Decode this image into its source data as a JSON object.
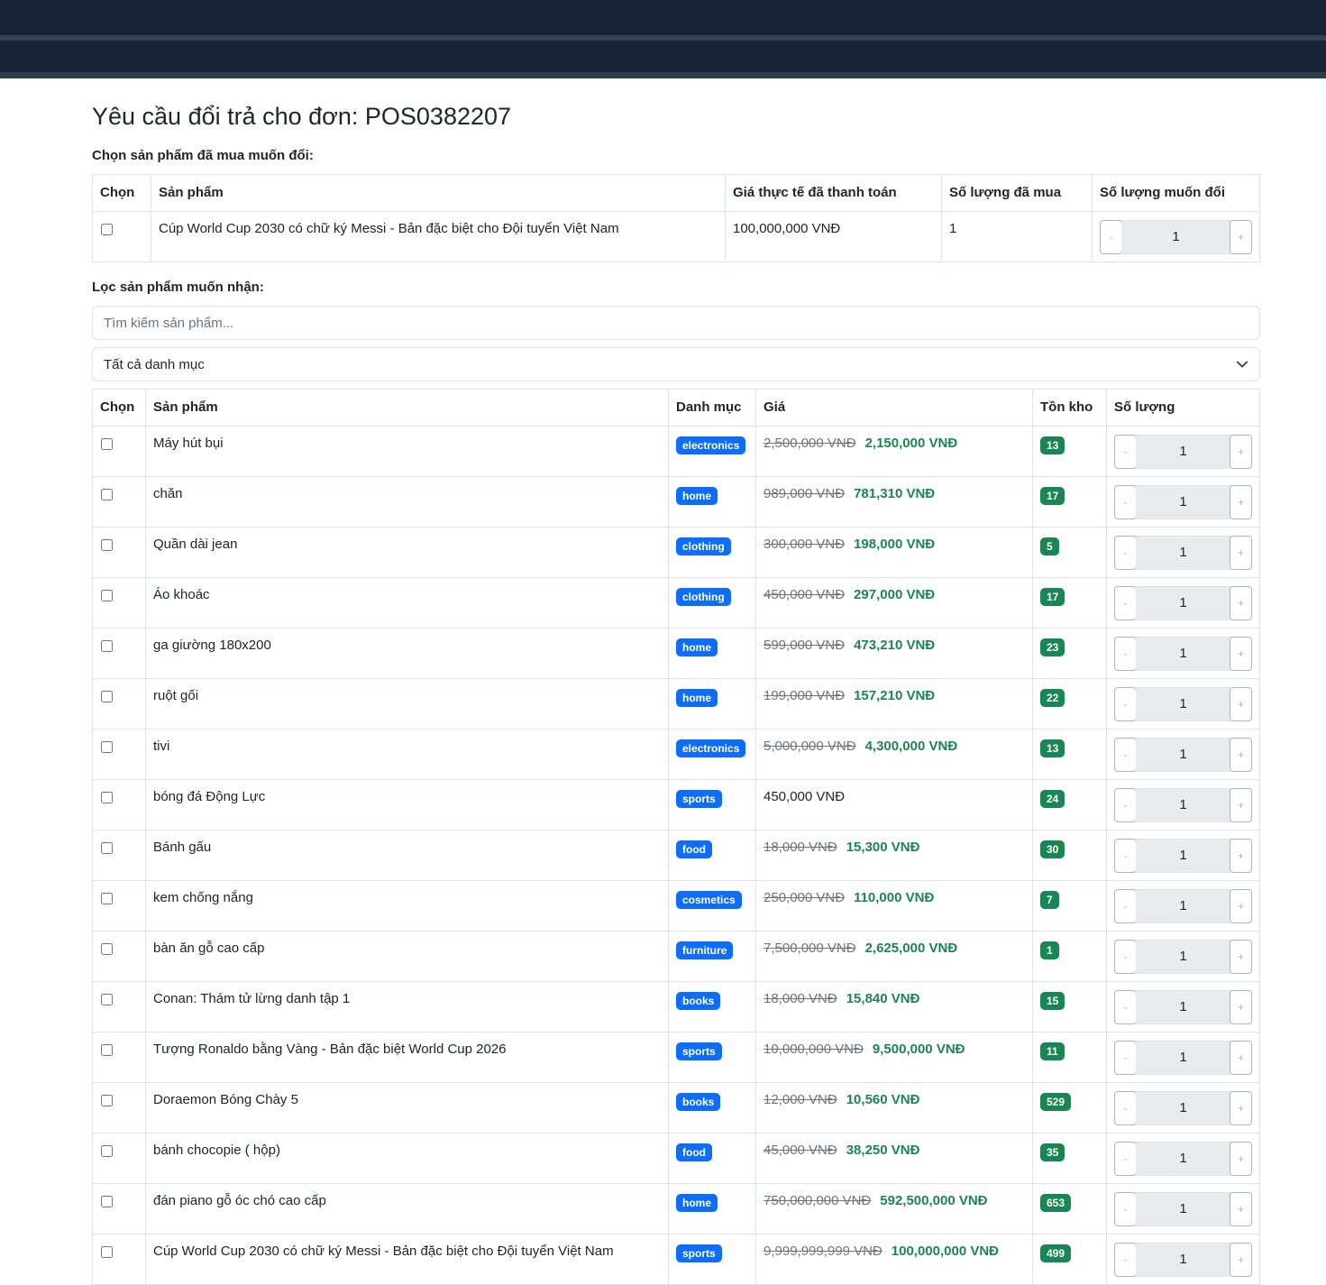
{
  "page_title": "Yêu cầu đổi trả cho đơn: POS0382207",
  "purchased_section": {
    "label": "Chọn sản phẩm đã mua muốn đổi:",
    "headers": [
      "Chọn",
      "Sản phẩm",
      "Giá thực tế đã thanh toán",
      "Số lượng đã mua",
      "Số lượng muốn đổi"
    ],
    "rows": [
      {
        "name": "Cúp World Cup 2030 có chữ ký Messi - Bản đặc biệt cho Đội tuyển Việt Nam",
        "paid": "100,000,000 VNĐ",
        "bought": "1",
        "qty": "1"
      }
    ]
  },
  "filter_section": {
    "label": "Lọc sản phẩm muốn nhận:",
    "search_placeholder": "Tìm kiếm sản phẩm...",
    "category_selected": "Tất cả danh mục"
  },
  "stepper": {
    "minus": "-",
    "plus": "+"
  },
  "products_table": {
    "headers": [
      "Chọn",
      "Sản phẩm",
      "Danh mục",
      "Giá",
      "Tồn kho",
      "Số lượng"
    ],
    "rows": [
      {
        "name": "Máy hút bụi",
        "category": "electronics",
        "old_price": "2,500,000 VNĐ",
        "price": "2,150,000 VNĐ",
        "stock": "13",
        "qty": "1"
      },
      {
        "name": "chăn",
        "category": "home",
        "old_price": "989,000 VNĐ",
        "price": "781,310 VNĐ",
        "stock": "17",
        "qty": "1"
      },
      {
        "name": "Quần dài jean",
        "category": "clothing",
        "old_price": "300,000 VNĐ",
        "price": "198,000 VNĐ",
        "stock": "5",
        "qty": "1"
      },
      {
        "name": "Áo khoác",
        "category": "clothing",
        "old_price": "450,000 VNĐ",
        "price": "297,000 VNĐ",
        "stock": "17",
        "qty": "1"
      },
      {
        "name": "ga giường 180x200",
        "category": "home",
        "old_price": "599,000 VNĐ",
        "price": "473,210 VNĐ",
        "stock": "23",
        "qty": "1"
      },
      {
        "name": "ruột gối",
        "category": "home",
        "old_price": "199,000 VNĐ",
        "price": "157,210 VNĐ",
        "stock": "22",
        "qty": "1"
      },
      {
        "name": "tivi",
        "category": "electronics",
        "old_price": "5,000,000 VNĐ",
        "price": "4,300,000 VNĐ",
        "stock": "13",
        "qty": "1"
      },
      {
        "name": "bóng đá Động Lực",
        "category": "sports",
        "old_price": "",
        "price": "450,000 VNĐ",
        "stock": "24",
        "qty": "1"
      },
      {
        "name": "Bánh gấu",
        "category": "food",
        "old_price": "18,000 VNĐ",
        "price": "15,300 VNĐ",
        "stock": "30",
        "qty": "1"
      },
      {
        "name": "kem chống nắng",
        "category": "cosmetics",
        "old_price": "250,000 VNĐ",
        "price": "110,000 VNĐ",
        "stock": "7",
        "qty": "1"
      },
      {
        "name": "bàn ăn gỗ cao cấp",
        "category": "furniture",
        "old_price": "7,500,000 VNĐ",
        "price": "2,625,000 VNĐ",
        "stock": "1",
        "qty": "1"
      },
      {
        "name": "Conan: Thám tử lừng danh tập 1",
        "category": "books",
        "old_price": "18,000 VNĐ",
        "price": "15,840 VNĐ",
        "stock": "15",
        "qty": "1"
      },
      {
        "name": "Tượng Ronaldo bằng Vàng - Bản đặc biệt World Cup 2026",
        "category": "sports",
        "old_price": "10,000,000 VNĐ",
        "price": "9,500,000 VNĐ",
        "stock": "11",
        "qty": "1"
      },
      {
        "name": "Doraemon Bóng Chày 5",
        "category": "books",
        "old_price": "12,000 VNĐ",
        "price": "10,560 VNĐ",
        "stock": "529",
        "qty": "1"
      },
      {
        "name": "bánh chocopie ( hộp)",
        "category": "food",
        "old_price": "45,000 VNĐ",
        "price": "38,250 VNĐ",
        "stock": "35",
        "qty": "1"
      },
      {
        "name": "đán piano gỗ óc chó cao cấp",
        "category": "home",
        "old_price": "750,000,000 VNĐ",
        "price": "592,500,000 VNĐ",
        "stock": "653",
        "qty": "1"
      },
      {
        "name": "Cúp World Cup 2030 có chữ ký Messi - Bản đặc biệt cho Đội tuyển Việt Nam",
        "category": "sports",
        "old_price": "9,999,999,999 VNĐ",
        "price": "100,000,000 VNĐ",
        "stock": "499",
        "qty": "1"
      }
    ]
  },
  "colors": {
    "topbar": "#182335",
    "category_badge": "#0d6efd",
    "stock_badge": "#198754",
    "sale_price": "#198754"
  },
  "icons": {
    "select_chevron": "chevron-down-icon"
  }
}
